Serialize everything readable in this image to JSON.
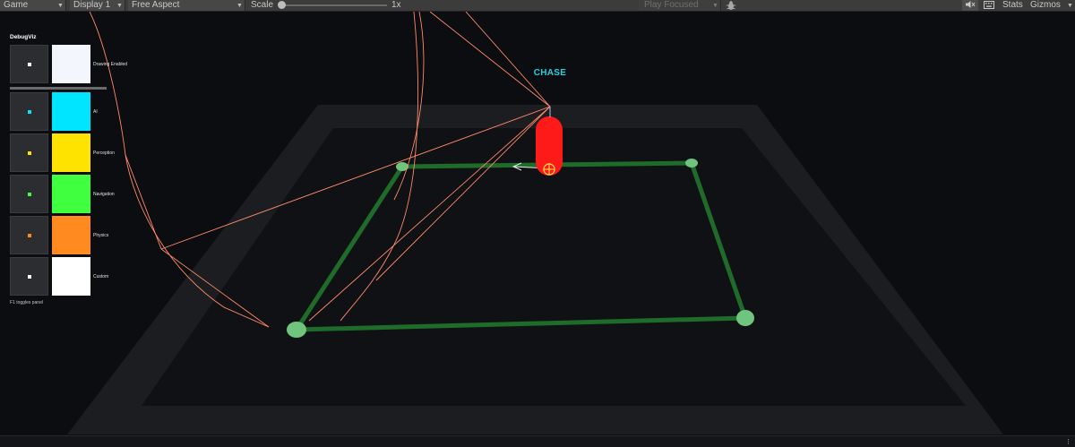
{
  "toolbar": {
    "game_tab": "Game",
    "display": "Display 1",
    "aspect": "Free Aspect",
    "scale_label": "Scale",
    "scale_value": "1x",
    "play_mode": "Play Focused",
    "stats": "Stats",
    "gizmos": "Gizmos"
  },
  "panel": {
    "title": "DebugViz",
    "rows": [
      {
        "label": "Drawing Enabled",
        "color": "#f3f6fc"
      },
      {
        "label": "AI",
        "color": "#00e5ff"
      },
      {
        "label": "Perception",
        "color": "#ffe300"
      },
      {
        "label": "Navigation",
        "color": "#3fff3f"
      },
      {
        "label": "Physics",
        "color": "#ff8a1f"
      },
      {
        "label": "Custom",
        "color": "#ffffff"
      }
    ],
    "hint": "F1 toggles panel"
  },
  "scene": {
    "agent_state": "CHASE",
    "colors": {
      "nav_path": "#1f6b2a",
      "waypoint": "#6fc47e",
      "agent": "#ff1a1a",
      "sight_lines": "#ff8a6a",
      "state_label": "#1fd3de"
    }
  }
}
